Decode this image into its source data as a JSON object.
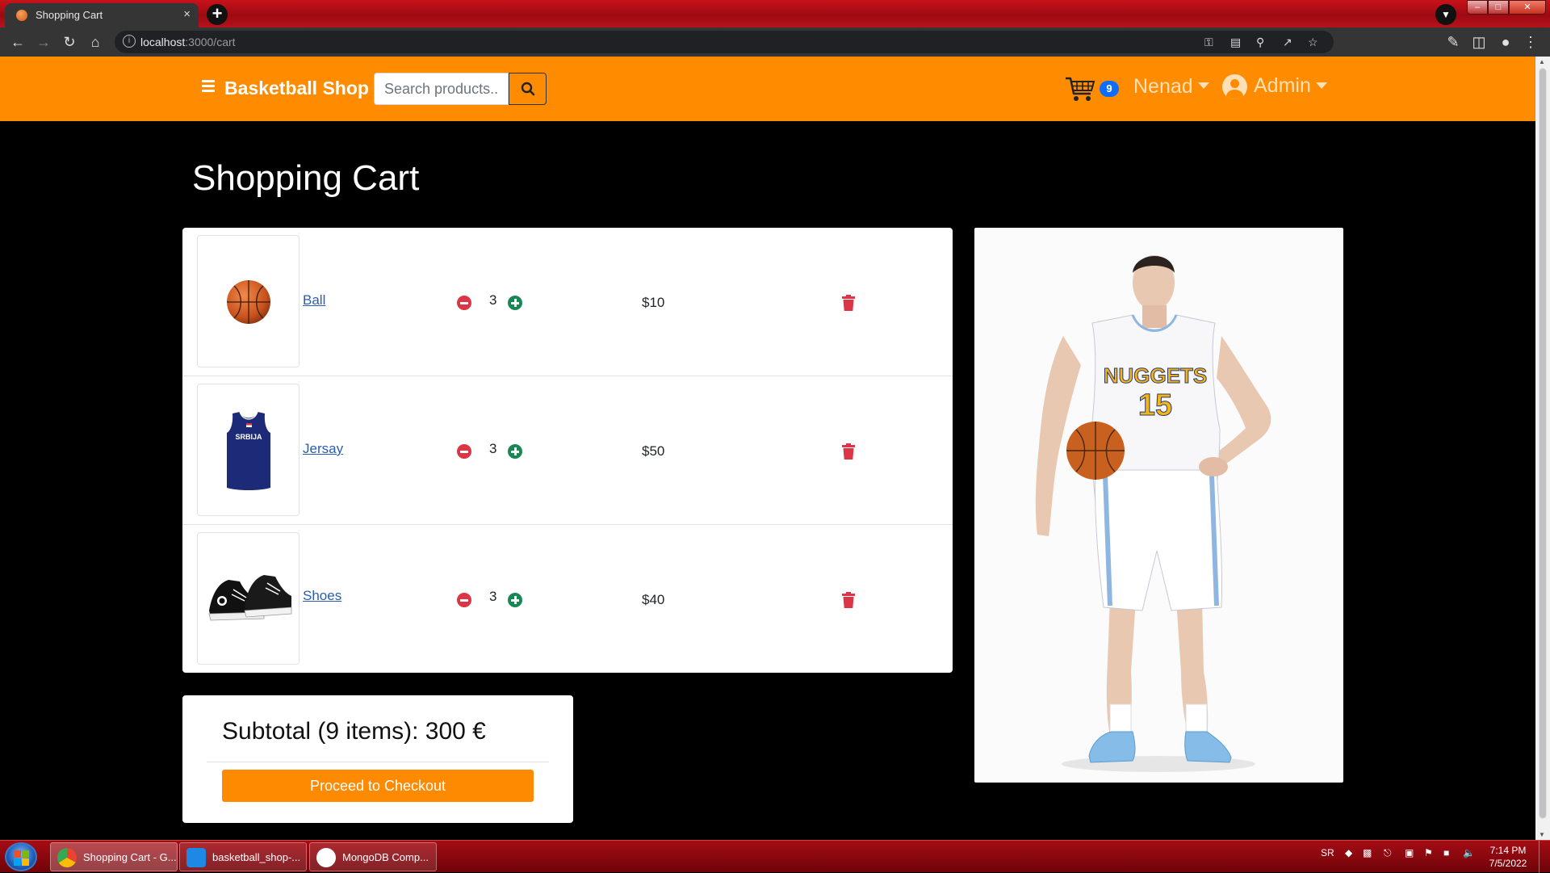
{
  "browser": {
    "tab_title": "Shopping Cart",
    "tab_close": "×",
    "url_host": "localhost",
    "url_path": ":3000/cart"
  },
  "navbar": {
    "brand": "Basketball Shop",
    "search_placeholder": "Search products...",
    "cart_count": "9",
    "user_name": "Nenad",
    "admin_label": "Admin",
    "accent_color": "#ff8c00"
  },
  "page": {
    "title": "Shopping Cart"
  },
  "cart": {
    "items": [
      {
        "name": "Ball",
        "quantity": "3",
        "price": "$10",
        "image": "basketball-image"
      },
      {
        "name": "Jersay",
        "quantity": "3",
        "price": "$50",
        "image": "jersey-image",
        "jersey_text": "SRBIJA"
      },
      {
        "name": "Shoes",
        "quantity": "3",
        "price": "$40",
        "image": "shoes-image"
      }
    ]
  },
  "summary": {
    "subtotal": "Subtotal (9 items): 300 €",
    "checkout_label": "Proceed to Checkout"
  },
  "player_image": {
    "jersey_text": "NUGGETS",
    "jersey_number": "15"
  },
  "taskbar": {
    "tasks": [
      {
        "label": "Shopping Cart - G..."
      },
      {
        "label": "basketball_shop-..."
      },
      {
        "label": "MongoDB Comp..."
      }
    ],
    "lang": "SR",
    "time": "7:14 PM",
    "date": "7/5/2022"
  }
}
